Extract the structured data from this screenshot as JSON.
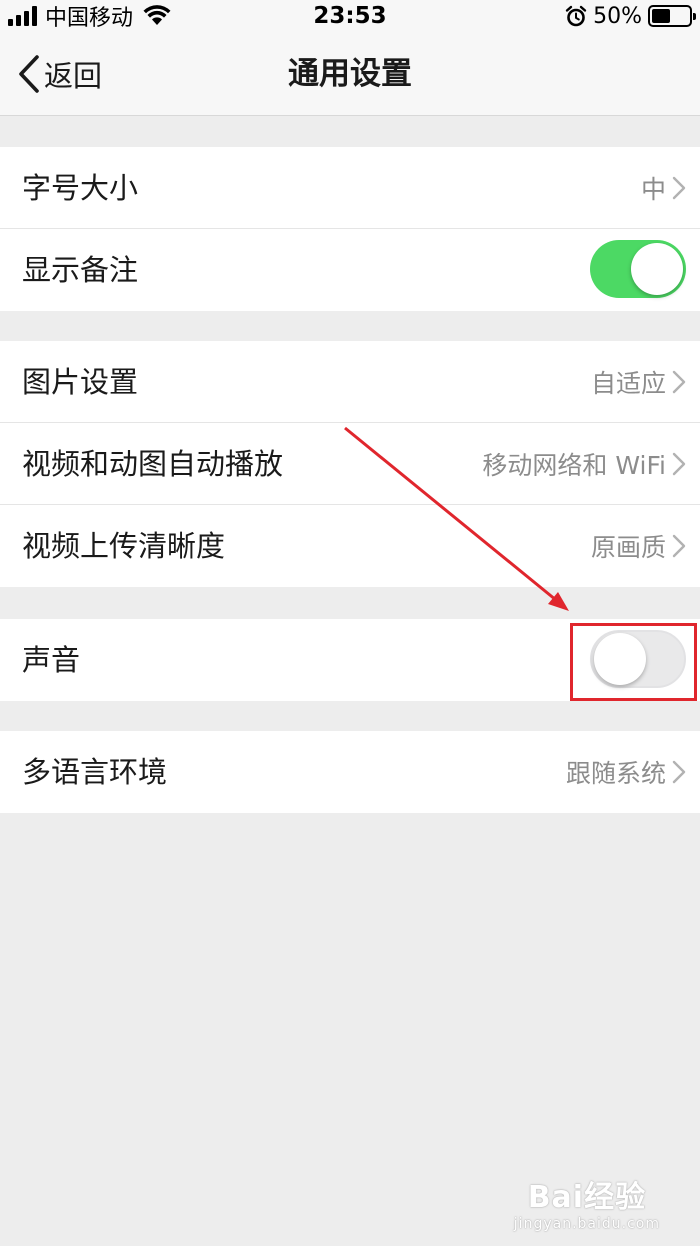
{
  "status_bar": {
    "carrier": "中国移动",
    "time": "23:53",
    "battery": "50%",
    "battery_level": 0.5,
    "icons": [
      "signal-icon",
      "wifi-icon",
      "alarm-icon",
      "battery-icon"
    ]
  },
  "nav": {
    "back_label": "返回",
    "title": "通用设置"
  },
  "groups": [
    {
      "rows": [
        {
          "label": "字号大小",
          "value": "中",
          "type": "disclosure"
        },
        {
          "label": "显示备注",
          "type": "toggle",
          "state": "on"
        }
      ]
    },
    {
      "rows": [
        {
          "label": "图片设置",
          "value": "自适应",
          "type": "disclosure"
        },
        {
          "label": "视频和动图自动播放",
          "value": "移动网络和 WiFi",
          "type": "disclosure"
        },
        {
          "label": "视频上传清晰度",
          "value": "原画质",
          "type": "disclosure"
        }
      ]
    },
    {
      "rows": [
        {
          "label": "声音",
          "type": "toggle",
          "state": "off"
        }
      ]
    },
    {
      "rows": [
        {
          "label": "多语言环境",
          "value": "跟随系统",
          "type": "disclosure"
        }
      ]
    }
  ],
  "annotation": {
    "color": "#e0262d",
    "target": "声音 toggle"
  },
  "watermark": {
    "brand": "Bai经验",
    "url": "jingyan.baidu.com"
  },
  "colors": {
    "background": "#ededed",
    "toggle_on": "#4cd964",
    "secondary_text": "#8c8c8c"
  }
}
